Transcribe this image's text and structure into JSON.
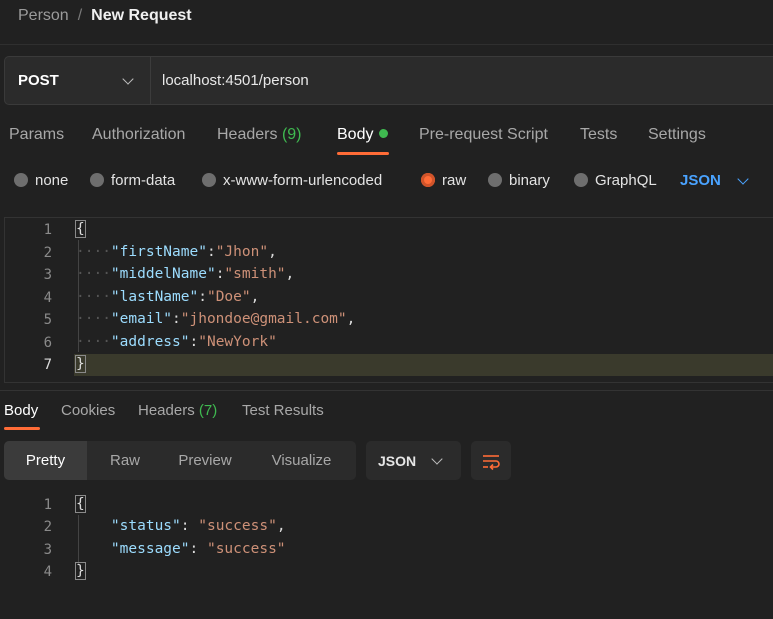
{
  "breadcrumb": {
    "parent": "Person",
    "separator": "/",
    "current": "New Request"
  },
  "request": {
    "method": "POST",
    "url": "localhost:4501/person"
  },
  "request_tabs": [
    {
      "label": "Params"
    },
    {
      "label": "Authorization"
    },
    {
      "label": "Headers",
      "count": "(9)"
    },
    {
      "label": "Body",
      "active": true
    },
    {
      "label": "Pre-request Script"
    },
    {
      "label": "Tests"
    },
    {
      "label": "Settings"
    }
  ],
  "body_types": {
    "options": [
      "none",
      "form-data",
      "x-www-form-urlencoded",
      "raw",
      "binary",
      "GraphQL"
    ],
    "selected": "raw",
    "language": "JSON"
  },
  "request_body": {
    "line_numbers": [
      "1",
      "2",
      "3",
      "4",
      "5",
      "6",
      "7"
    ],
    "open_brace": "{",
    "close_brace": "}",
    "fields": [
      {
        "key": "\"firstName\"",
        "value": "\"Jhon\"",
        "comma": ","
      },
      {
        "key": "\"middelName\"",
        "value": "\"smith\"",
        "comma": ","
      },
      {
        "key": "\"lastName\"",
        "value": "\"Doe\"",
        "comma": ","
      },
      {
        "key": "\"email\"",
        "value": "\"jhondoe@gmail.com\"",
        "comma": ","
      },
      {
        "key": "\"address\"",
        "value": "\"NewYork\"",
        "comma": ""
      }
    ]
  },
  "response_tabs": [
    {
      "label": "Body",
      "active": true
    },
    {
      "label": "Cookies"
    },
    {
      "label": "Headers",
      "count": "(7)"
    },
    {
      "label": "Test Results"
    }
  ],
  "response_view": {
    "modes": [
      "Pretty",
      "Raw",
      "Preview",
      "Visualize"
    ],
    "selected": "Pretty",
    "language": "JSON"
  },
  "response_body": {
    "line_numbers": [
      "1",
      "2",
      "3",
      "4"
    ],
    "open_brace": "{",
    "close_brace": "}",
    "fields": [
      {
        "key": "\"status\"",
        "value": "\"success\"",
        "comma": ","
      },
      {
        "key": "\"message\"",
        "value": "\"success\"",
        "comma": ""
      }
    ]
  },
  "colors": {
    "accent": "#ff6c37",
    "count_green": "#3fb950",
    "json_blue": "#4aa3ff"
  },
  "icons": {
    "method_dropdown": "chevron-down-icon",
    "wrap_toggle": "wrap-lines-icon"
  }
}
